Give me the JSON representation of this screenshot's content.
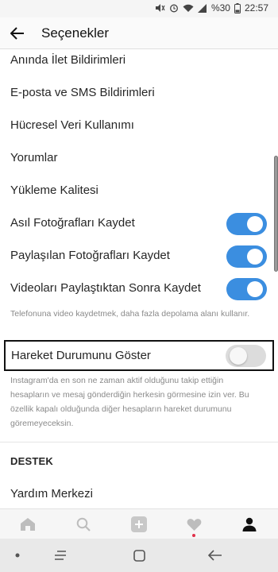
{
  "status_bar": {
    "battery": "%30",
    "time": "22:57"
  },
  "header": {
    "title": "Seçenekler"
  },
  "settings": {
    "items": [
      {
        "label": "Anında İlet Bildirimleri"
      },
      {
        "label": "E-posta ve SMS Bildirimleri"
      },
      {
        "label": "Hücresel Veri Kullanımı"
      },
      {
        "label": "Yorumlar"
      },
      {
        "label": "Yükleme Kalitesi"
      }
    ],
    "toggles": [
      {
        "label": "Asıl Fotoğrafları Kaydet",
        "on": true
      },
      {
        "label": "Paylaşılan Fotoğrafları Kaydet",
        "on": true
      },
      {
        "label": "Videoları Paylaştıktan Sonra Kaydet",
        "on": true
      }
    ],
    "video_note": "Telefonuna video kaydetmek, daha fazla depolama alanı kullanır.",
    "activity_status": {
      "label": "Hareket Durumunu Göster",
      "on": false
    },
    "activity_note": "Instagram'da en son ne zaman aktif olduğunu takip ettiğin hesapların ve mesaj gönderdiğin herkesin görmesine izin ver. Bu özellik kapalı olduğunda diğer hesapların hareket durumunu göremeyeceksin."
  },
  "support": {
    "header": "DESTEK",
    "help_center": "Yardım Merkezi"
  },
  "colors": {
    "toggle_on": "#3b8ee0",
    "toggle_off": "#dcdcdc",
    "notification_dot": "#e0304a"
  },
  "tab_bar": {
    "icons": [
      "home-icon",
      "search-icon",
      "add-icon",
      "heart-icon",
      "profile-icon"
    ]
  },
  "nav_bar": {
    "icons": [
      "dot-icon",
      "recents-icon",
      "home-square-icon",
      "back-arrow-icon"
    ]
  }
}
